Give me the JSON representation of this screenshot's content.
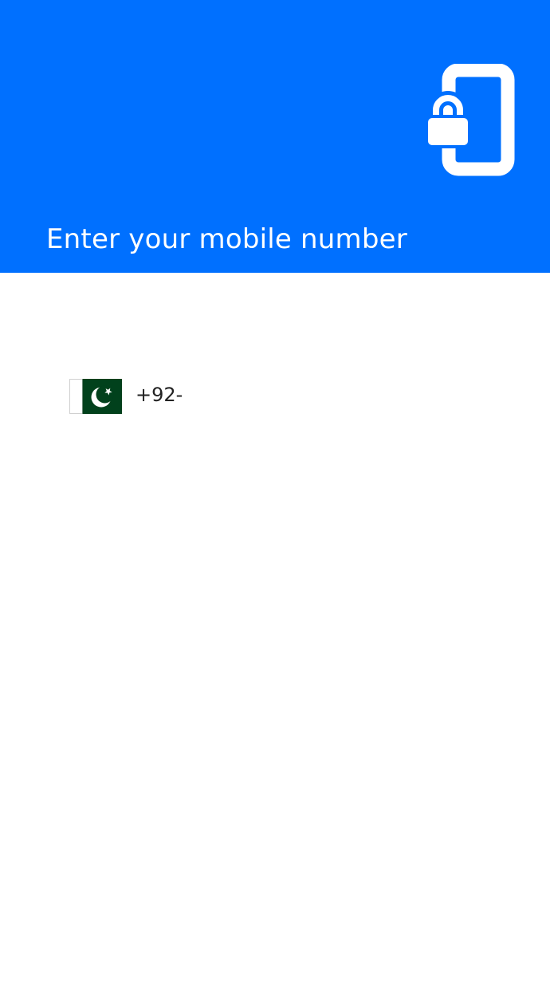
{
  "header": {
    "title": "Enter your mobile number",
    "background_color": "#0070ff",
    "icon": "phone-lock-icon"
  },
  "phone_input": {
    "country_flag": "pakistan-flag-icon",
    "country_code_prefix": "+92-",
    "value": ""
  }
}
